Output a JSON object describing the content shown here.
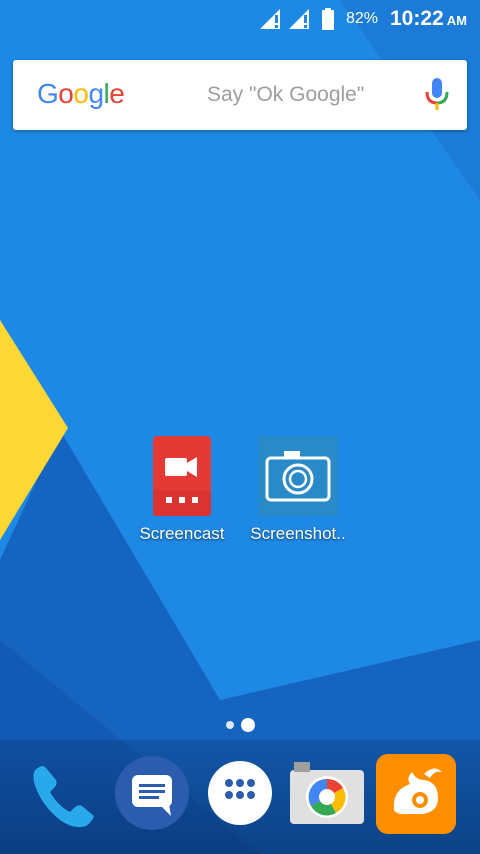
{
  "status_bar": {
    "battery_percent": "82%",
    "time": "10:22",
    "ampm": "AM",
    "icons": [
      "signal-sim1-icon",
      "signal-sim2-icon",
      "battery-icon"
    ]
  },
  "search": {
    "logo_text": [
      "G",
      "o",
      "o",
      "g",
      "l",
      "e"
    ],
    "logo_colors": [
      "#4285F4",
      "#EA4335",
      "#FBBC05",
      "#4285F4",
      "#34A853",
      "#EA4335"
    ],
    "hint": "Say \"Ok Google\""
  },
  "apps": [
    {
      "label": "Screencast",
      "icon": "screencast-icon",
      "color": "#e53935"
    },
    {
      "label": "Screenshot..",
      "icon": "screenshot-camera-icon",
      "color": "#2a8ac8"
    }
  ],
  "pages": {
    "count": 2,
    "current": 2
  },
  "dock": [
    {
      "name": "phone",
      "icon": "phone-icon"
    },
    {
      "name": "messages",
      "icon": "messages-icon"
    },
    {
      "name": "all-apps",
      "icon": "app-drawer-icon"
    },
    {
      "name": "camera",
      "icon": "camera-app-icon"
    },
    {
      "name": "uc-browser",
      "icon": "uc-browser-icon"
    }
  ],
  "colors": {
    "wallpaper_blue": "#1e88e5",
    "wallpaper_dark": "#1565c0",
    "wallpaper_yellow": "#fdd835"
  }
}
